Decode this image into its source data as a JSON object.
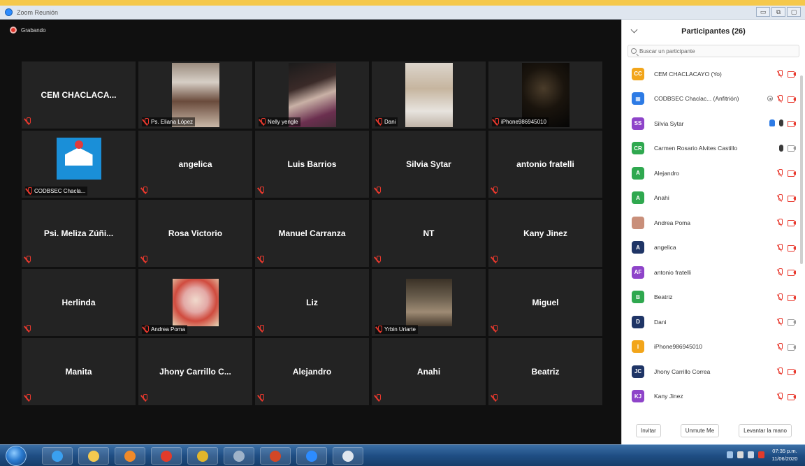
{
  "window": {
    "title": "Zoom Reunión",
    "controls": [
      "▭",
      "⧉",
      "▢"
    ]
  },
  "meeting": {
    "recording_label": "Grabando",
    "tiles": [
      {
        "name": "CEM CHACLACA...",
        "kind": "name"
      },
      {
        "name": "Ps. Eliana López",
        "kind": "video"
      },
      {
        "name": "Nelly yengle",
        "kind": "video"
      },
      {
        "name": "Dani",
        "kind": "video"
      },
      {
        "name": "iPhone986945010",
        "kind": "video"
      },
      {
        "name": "CODBSEC Chacla...",
        "kind": "logo"
      },
      {
        "name": "angelica",
        "kind": "name"
      },
      {
        "name": "Luis Barrios",
        "kind": "name"
      },
      {
        "name": "Silvia Sytar",
        "kind": "name"
      },
      {
        "name": "antonio fratelli",
        "kind": "name"
      },
      {
        "name": "Psi. Meliza Zúñi...",
        "kind": "name"
      },
      {
        "name": "Rosa Victorio",
        "kind": "name"
      },
      {
        "name": "Manuel Carranza",
        "kind": "name"
      },
      {
        "name": "NT",
        "kind": "name"
      },
      {
        "name": "Kany Jinez",
        "kind": "name"
      },
      {
        "name": "Herlinda",
        "kind": "name"
      },
      {
        "name": "Andrea Poma",
        "kind": "video"
      },
      {
        "name": "Liz",
        "kind": "name"
      },
      {
        "name": "Yrbin Uriarte",
        "kind": "video"
      },
      {
        "name": "Miguel",
        "kind": "name"
      },
      {
        "name": "Manita",
        "kind": "name"
      },
      {
        "name": "Jhony Carrillo C...",
        "kind": "name"
      },
      {
        "name": "Alejandro",
        "kind": "name"
      },
      {
        "name": "Anahi",
        "kind": "name"
      },
      {
        "name": "Beatriz",
        "kind": "name"
      }
    ]
  },
  "participants": {
    "title": "Participantes (26)",
    "search_placeholder": "Buscar un participante",
    "list": [
      {
        "initials": "CC",
        "color": "#f2a51a",
        "name": "CEM CHACLACAYO (Yo)",
        "mic": "off",
        "cam": "off"
      },
      {
        "initials": "▦",
        "color": "#2d7be5",
        "name": "CODBSEC Chaclac... (Anfitrión)",
        "mic": "off",
        "cam": "off",
        "rec": true
      },
      {
        "initials": "SS",
        "color": "#8e44c9",
        "name": "Silvia Sytar",
        "mic": "on",
        "cam": "off",
        "hand": true
      },
      {
        "initials": "CR",
        "color": "#2fa84f",
        "name": "Carmen Rosario Alvites Castillo",
        "mic": "on",
        "cam": "grey"
      },
      {
        "initials": "A",
        "color": "#2fa84f",
        "name": "Alejandro",
        "mic": "off",
        "cam": "off"
      },
      {
        "initials": "A",
        "color": "#2fa84f",
        "name": "Anahi",
        "mic": "off",
        "cam": "off"
      },
      {
        "initials": "",
        "color": "#c98f7a",
        "name": "Andrea Poma",
        "mic": "off",
        "cam": "off"
      },
      {
        "initials": "A",
        "color": "#1f3566",
        "name": "angelica",
        "mic": "off",
        "cam": "off"
      },
      {
        "initials": "AF",
        "color": "#8e44c9",
        "name": "antonio fratelli",
        "mic": "off",
        "cam": "off"
      },
      {
        "initials": "B",
        "color": "#2fa84f",
        "name": "Beatriz",
        "mic": "off",
        "cam": "off"
      },
      {
        "initials": "D",
        "color": "#1f3566",
        "name": "Dani",
        "mic": "off",
        "cam": "grey"
      },
      {
        "initials": "I",
        "color": "#f2a51a",
        "name": "iPhone986945010",
        "mic": "off",
        "cam": "grey"
      },
      {
        "initials": "JC",
        "color": "#1f3566",
        "name": "Jhony Carrillo Correa",
        "mic": "off",
        "cam": "off"
      },
      {
        "initials": "KJ",
        "color": "#8e44c9",
        "name": "Kany Jinez",
        "mic": "off",
        "cam": "off"
      }
    ],
    "footer": {
      "invite": "Invitar",
      "unmute": "Unmute Me",
      "raise_hand": "Levantar la mano"
    }
  },
  "taskbar": {
    "apps": [
      {
        "icon": "internet-explorer-icon",
        "color": "#3aa0f0"
      },
      {
        "icon": "file-explorer-icon",
        "color": "#f3c94f"
      },
      {
        "icon": "media-player-icon",
        "color": "#f08a2a"
      },
      {
        "icon": "chrome-icon",
        "color": "#e23b2b"
      },
      {
        "icon": "opera-icon",
        "color": "#e2b62b"
      },
      {
        "icon": "paint-icon",
        "color": "#9fb3c9"
      },
      {
        "icon": "powerpoint-icon",
        "color": "#d24726"
      },
      {
        "icon": "zoom-icon",
        "color": "#2d8cff"
      },
      {
        "icon": "notepad-icon",
        "color": "#dfe6ee"
      }
    ],
    "clock_time": "07:35 p.m.",
    "clock_date": "11/06/2020"
  }
}
